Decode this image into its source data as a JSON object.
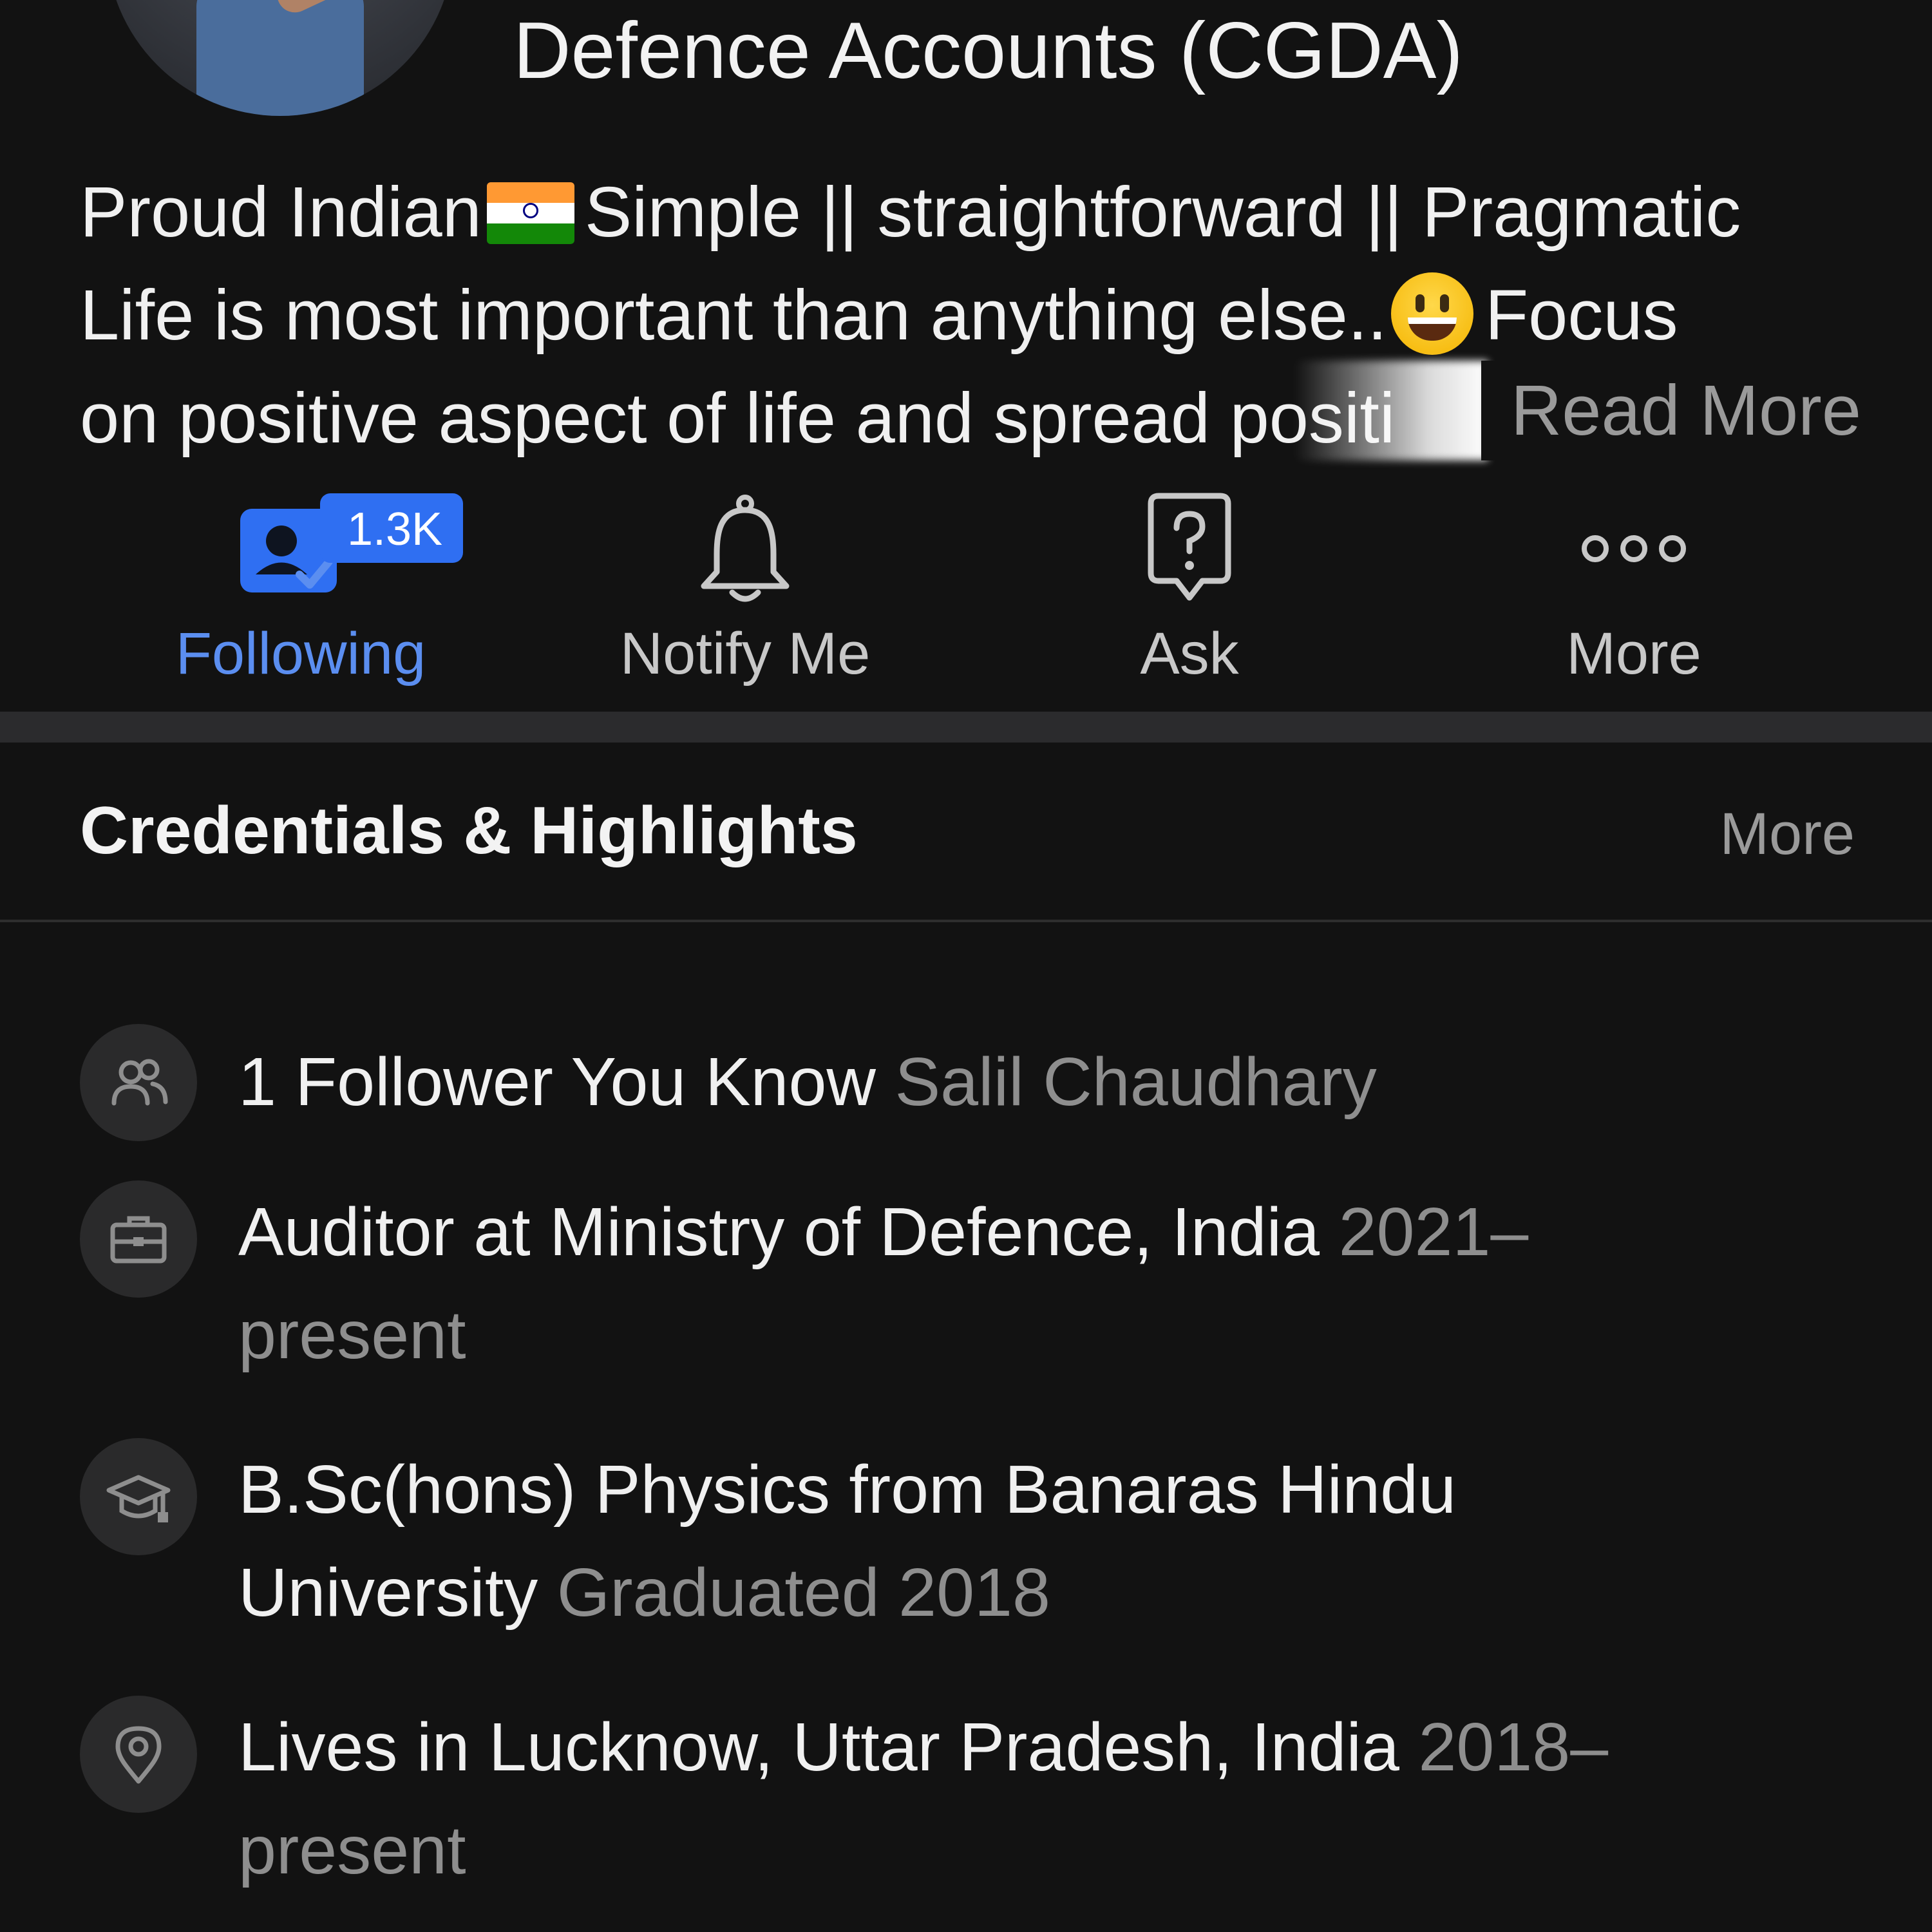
{
  "profile": {
    "title": "Defence Accounts (CGDA)",
    "bio": {
      "line1_part1": "Proud Indian",
      "line1_part2": "Simple || straightforward || Pragmatic",
      "line2_part1": "Life is most important than anything else..",
      "line2_part2": "Focus",
      "line3": "on positive aspect of life and spread positi",
      "read_more": "Read More",
      "flag_icon": "india-flag-emoji",
      "smile_icon": "grinning-face-emoji"
    }
  },
  "actions": [
    {
      "label": "Following",
      "badge": "1.3K",
      "icon": "person-check-icon",
      "active": true
    },
    {
      "label": "Notify Me",
      "icon": "bell-icon",
      "active": false
    },
    {
      "label": "Ask",
      "icon": "question-bubble-icon",
      "active": false
    },
    {
      "label": "More",
      "icon": "more-dots-icon",
      "active": false
    }
  ],
  "credentials": {
    "title": "Credentials & Highlights",
    "more_label": "More",
    "items": [
      {
        "icon": "people-icon",
        "main": "1 Follower You Know",
        "muted": "Salil Chaudhary"
      },
      {
        "icon": "briefcase-icon",
        "main": "Auditor at Ministry of Defence, India",
        "muted": "2021–",
        "muted2": "present"
      },
      {
        "icon": "graduation-cap-icon",
        "main": "B.Sc(hons) Physics from Banaras Hindu",
        "main2": "University",
        "muted": "Graduated 2018"
      },
      {
        "icon": "location-pin-icon",
        "main": "Lives in Lucknow, Uttar Pradesh, India",
        "muted": "2018–",
        "muted2": "present"
      }
    ]
  },
  "colors": {
    "background": "#121212",
    "accent": "#5b8ef0",
    "badge": "#2f6ff2",
    "muted_text": "#8e8e8e"
  }
}
